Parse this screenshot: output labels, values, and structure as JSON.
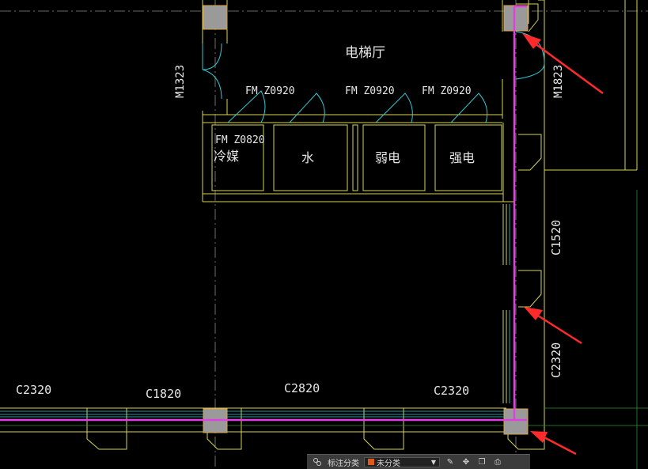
{
  "title": "电梯厅",
  "rooms": [
    {
      "name": "冷媒",
      "door": "FM Z0820"
    },
    {
      "name": "水",
      "door": "FM Z0920"
    },
    {
      "name": "弱电",
      "door": "FM Z0920"
    },
    {
      "name": "强电",
      "door": "FM Z0920"
    }
  ],
  "doors": {
    "left": "M1323",
    "right": "M1823"
  },
  "windows": {
    "bottom": [
      "C2320",
      "C1820",
      "C2820",
      "C2320"
    ],
    "right": [
      "C1520",
      "C2320"
    ]
  },
  "toolbar": {
    "label": "标注分类",
    "select_value": "未分类",
    "select_color": "#e05a1a"
  },
  "colors": {
    "background": "#000000",
    "wall": "#d8d450",
    "door_arc": "#2fc9d6",
    "highlight_path": "#e040e0",
    "arrow": "#ff2a2a",
    "column": "#9a9a9a",
    "axis": "#8a8a8a",
    "green_line": "#2e8f2e"
  }
}
